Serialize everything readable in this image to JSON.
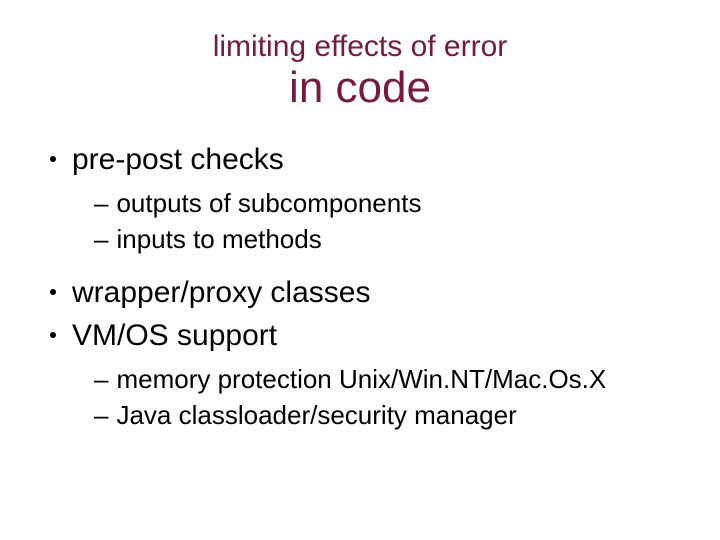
{
  "title": {
    "line1": "limiting effects of error",
    "line2": "in code"
  },
  "bullets": [
    {
      "text": "pre-post checks",
      "subs": [
        "outputs of subcomponents",
        "inputs to methods"
      ]
    },
    {
      "text": "wrapper/proxy classes",
      "subs": []
    },
    {
      "text": "VM/OS support",
      "subs": [
        "memory protection Unix/Win.NT/Mac.Os.X",
        "Java classloader/security manager"
      ]
    }
  ]
}
